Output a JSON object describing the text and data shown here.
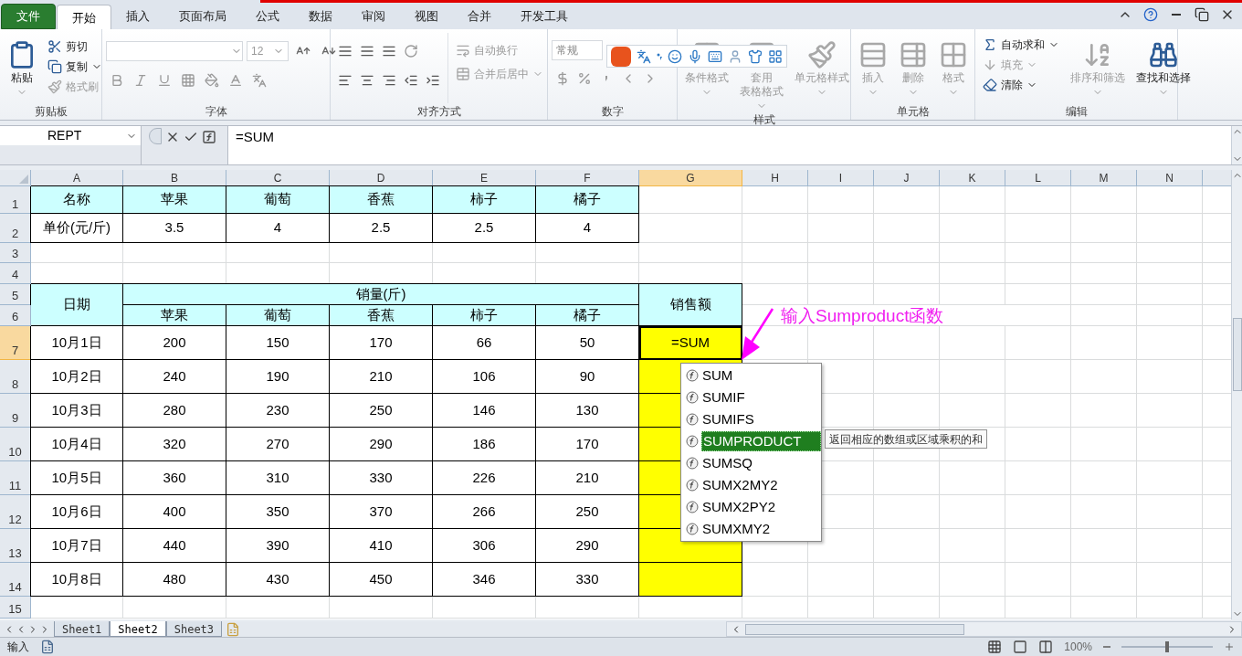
{
  "tabs": [
    {
      "label": "文件",
      "kind": "file",
      "selected": false
    },
    {
      "label": "开始",
      "kind": "tab",
      "selected": true
    },
    {
      "label": "插入",
      "kind": "tab",
      "selected": false
    },
    {
      "label": "页面布局",
      "kind": "tab",
      "selected": false
    },
    {
      "label": "公式",
      "kind": "tab",
      "selected": false
    },
    {
      "label": "数据",
      "kind": "tab",
      "selected": false
    },
    {
      "label": "审阅",
      "kind": "tab",
      "selected": false
    },
    {
      "label": "视图",
      "kind": "tab",
      "selected": false
    },
    {
      "label": "合并",
      "kind": "tab",
      "selected": false
    },
    {
      "label": "开发工具",
      "kind": "tab",
      "selected": false
    }
  ],
  "ribbon": {
    "clipboard": {
      "label": "剪贴板",
      "paste": {
        "label": "粘贴",
        "disabled": false
      },
      "cut": {
        "label": "剪切",
        "disabled": false
      },
      "copy": {
        "label": "复制",
        "disabled": false
      },
      "format_painter": {
        "label": "格式刷",
        "disabled": true
      }
    },
    "font": {
      "label": "字体",
      "font_size": "12"
    },
    "alignment": {
      "label": "对齐方式",
      "wrap_text": {
        "label": "自动换行",
        "disabled": true
      },
      "merge_center": {
        "label": "合并后居中",
        "disabled": true
      }
    },
    "number": {
      "label": "数字",
      "format": "常规"
    },
    "styles": {
      "label": "样式",
      "conditional_format": {
        "lines": [
          "条件格式"
        ],
        "disabled": true
      },
      "table_format": {
        "lines": [
          "套用",
          "表格格式"
        ],
        "disabled": true
      },
      "cell_styles": {
        "lines": [
          "单元格样式"
        ],
        "disabled": true
      }
    },
    "cells": {
      "label": "单元格",
      "insert": {
        "label": "插入",
        "disabled": true
      },
      "delete": {
        "label": "删除",
        "disabled": true
      },
      "format": {
        "label": "格式",
        "disabled": true
      }
    },
    "editing": {
      "label": "编辑",
      "autosum": {
        "label": "自动求和",
        "disabled": false
      },
      "fill": {
        "label": "填充",
        "disabled": true
      },
      "clear": {
        "label": "清除",
        "disabled": false
      },
      "sort_filter": {
        "label": "排序和筛选",
        "disabled": true
      },
      "find_select": {
        "label": "查找和选择",
        "disabled": false
      }
    }
  },
  "formula_bar": {
    "name_box": "REPT",
    "formula": "=SUM"
  },
  "sheet": {
    "columns": [
      {
        "label": "A",
        "selected": false
      },
      {
        "label": "B",
        "selected": false
      },
      {
        "label": "C",
        "selected": false
      },
      {
        "label": "D",
        "selected": false
      },
      {
        "label": "E",
        "selected": false
      },
      {
        "label": "F",
        "selected": false
      },
      {
        "label": "G",
        "selected": true
      },
      {
        "label": "H",
        "selected": false
      },
      {
        "label": "I",
        "selected": false
      },
      {
        "label": "J",
        "selected": false
      },
      {
        "label": "K",
        "selected": false
      },
      {
        "label": "L",
        "selected": false
      },
      {
        "label": "M",
        "selected": false
      },
      {
        "label": "N",
        "selected": false
      }
    ],
    "rows": [
      {
        "label": "1",
        "selected": false
      },
      {
        "label": "2",
        "selected": false
      },
      {
        "label": "3",
        "selected": false
      },
      {
        "label": "4",
        "selected": false
      },
      {
        "label": "5",
        "selected": false
      },
      {
        "label": "6",
        "selected": false
      },
      {
        "label": "7",
        "selected": true
      },
      {
        "label": "8",
        "selected": false
      },
      {
        "label": "9",
        "selected": false
      },
      {
        "label": "10",
        "selected": false
      },
      {
        "label": "11",
        "selected": false
      },
      {
        "label": "12",
        "selected": false
      },
      {
        "label": "13",
        "selected": false
      },
      {
        "label": "14",
        "selected": false
      },
      {
        "label": "15",
        "selected": false
      }
    ],
    "price_table": {
      "header": [
        "名称",
        "苹果",
        "葡萄",
        "香蕉",
        "柿子",
        "橘子"
      ],
      "row": [
        "单价(元/斤)",
        "3.5",
        "4",
        "2.5",
        "2.5",
        "4"
      ]
    },
    "sales_table": {
      "date_header": "日期",
      "quantity_header": "销量(斤)",
      "amount_header": "销售额",
      "fruits": [
        "苹果",
        "葡萄",
        "香蕉",
        "柿子",
        "橘子"
      ],
      "rows": [
        {
          "date": "10月1日",
          "values": [
            "200",
            "150",
            "170",
            "66",
            "50"
          ],
          "amount": "=SUM"
        },
        {
          "date": "10月2日",
          "values": [
            "240",
            "190",
            "210",
            "106",
            "90"
          ],
          "amount": ""
        },
        {
          "date": "10月3日",
          "values": [
            "280",
            "230",
            "250",
            "146",
            "130"
          ],
          "amount": ""
        },
        {
          "date": "10月4日",
          "values": [
            "320",
            "270",
            "290",
            "186",
            "170"
          ],
          "amount": ""
        },
        {
          "date": "10月5日",
          "values": [
            "360",
            "310",
            "330",
            "226",
            "210"
          ],
          "amount": ""
        },
        {
          "date": "10月6日",
          "values": [
            "400",
            "350",
            "370",
            "266",
            "250"
          ],
          "amount": ""
        },
        {
          "date": "10月7日",
          "values": [
            "440",
            "390",
            "410",
            "306",
            "290"
          ],
          "amount": ""
        },
        {
          "date": "10月8日",
          "values": [
            "480",
            "430",
            "450",
            "346",
            "330"
          ],
          "amount": ""
        }
      ]
    },
    "annotation": "输入Sumproduct函数",
    "autocomplete": [
      {
        "label": "SUM",
        "selected": false
      },
      {
        "label": "SUMIF",
        "selected": false
      },
      {
        "label": "SUMIFS",
        "selected": false
      },
      {
        "label": "SUMPRODUCT",
        "selected": true
      },
      {
        "label": "SUMSQ",
        "selected": false
      },
      {
        "label": "SUMX2MY2",
        "selected": false
      },
      {
        "label": "SUMX2PY2",
        "selected": false
      },
      {
        "label": "SUMXMY2",
        "selected": false
      }
    ],
    "tooltip": "返回相应的数组或区域乘积的和"
  },
  "sheet_tabs": [
    {
      "label": "Sheet1",
      "selected": false
    },
    {
      "label": "Sheet2",
      "selected": true
    },
    {
      "label": "Sheet3",
      "selected": false
    }
  ],
  "status_bar": {
    "mode": "输入",
    "zoom": "100%",
    "zoom_level": {
      "level": 0.5
    }
  }
}
